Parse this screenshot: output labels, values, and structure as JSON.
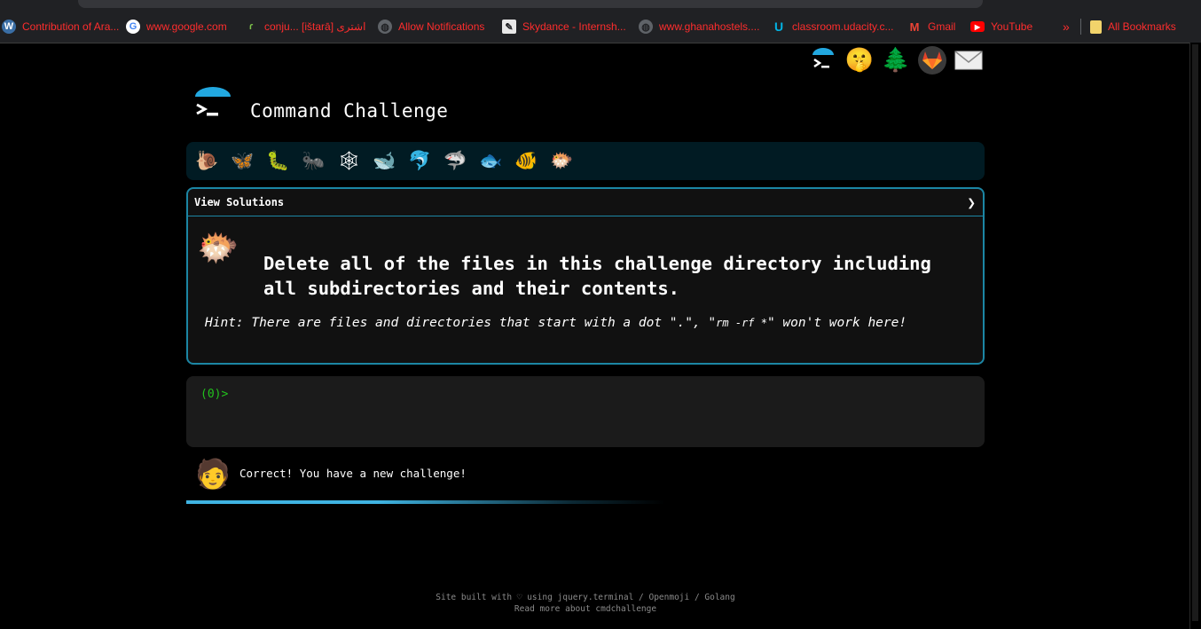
{
  "bookmarks": [
    {
      "label": "Contribution of Ara...",
      "icon": "wordpress-icon"
    },
    {
      "label": "www.google.com",
      "icon": "google-icon"
    },
    {
      "label": "conju... [ištarā] اشترى",
      "icon": "bookmark-green-icon"
    },
    {
      "label": "Allow Notifications",
      "icon": "globe-icon"
    },
    {
      "label": "Skydance - Internsh...",
      "icon": "pen-icon"
    },
    {
      "label": "www.ghanahostels....",
      "icon": "globe-icon"
    },
    {
      "label": "classroom.udacity.c...",
      "icon": "udacity-icon"
    },
    {
      "label": "Gmail",
      "icon": "gmail-icon"
    },
    {
      "label": "YouTube",
      "icon": "youtube-icon"
    }
  ],
  "bookmarks_overflow": "»",
  "all_bookmarks_label": "All Bookmarks",
  "nav_icons": [
    "terminal-icon",
    "shushing-face-icon",
    "tree-icon",
    "gitlab-fox-icon",
    "mail-icon"
  ],
  "header": {
    "title": "Command Challenge"
  },
  "creatures": [
    "snail",
    "butterfly",
    "caterpillar",
    "ant",
    "spider-web",
    "whale",
    "dolphin",
    "shark",
    "fish",
    "tropical-fish",
    "blowfish"
  ],
  "panel": {
    "view_solutions_label": "View Solutions",
    "arrow": "❯",
    "task": "Delete all of the files in this challenge directory including all subdirectories and their contents.",
    "hint_prefix": "Hint: There are files and directories that start with a dot \".\", \"",
    "hint_code": "rm -rf *",
    "hint_suffix": "\" won't work here!"
  },
  "terminal": {
    "prompt": "(0)>"
  },
  "feedback": {
    "message": "Correct! You have a new challenge!"
  },
  "progress": 0.6,
  "footer": {
    "line1": "Site built with ♡ using jquery.terminal / Openmoji / Golang",
    "line2": "Read more about cmdchallenge"
  },
  "colors": {
    "accent": "#1c86a4",
    "prompt": "#22c21d",
    "bookmark_text": "#ff2d2d",
    "creature_bar": "#011b23"
  }
}
